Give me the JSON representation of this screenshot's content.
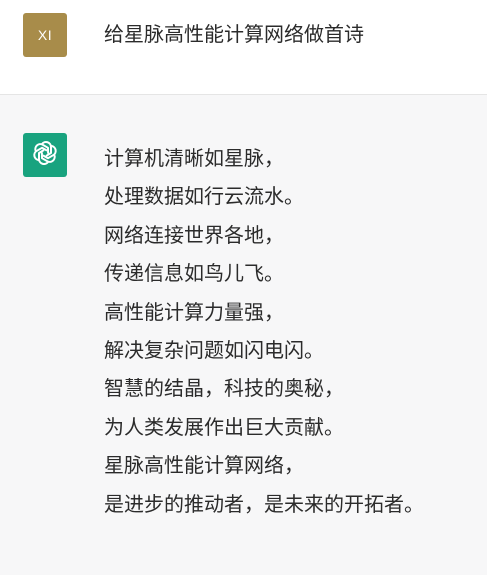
{
  "user_message": {
    "avatar_initials": "XI",
    "text": "给星脉高性能计算网络做首诗"
  },
  "assistant_message": {
    "avatar_icon": "openai-logo-icon",
    "poem_lines": [
      "计算机清晰如星脉，",
      "处理数据如行云流水。",
      "网络连接世界各地，",
      "传递信息如鸟儿飞。",
      "高性能计算力量强，",
      "解决复杂问题如闪电闪。",
      "智慧的结晶，科技的奥秘，",
      "为人类发展作出巨大贡献。",
      "星脉高性能计算网络，",
      "是进步的推动者，是未来的开拓者。"
    ]
  },
  "colors": {
    "user_avatar_bg": "#a88c4a",
    "assistant_avatar_bg": "#19a37f",
    "assistant_row_bg": "#f7f7f8",
    "text": "#2b2b2b"
  }
}
